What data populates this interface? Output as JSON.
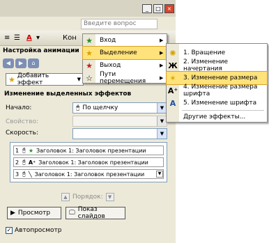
{
  "window": {
    "search_placeholder": "Введите вопрос",
    "btn_min": "_",
    "btn_max": "□",
    "btn_close": "×"
  },
  "toolbar": {
    "font_color_icon": "A",
    "kon_label": "Кон"
  },
  "pane": {
    "title": "Настройка анимации",
    "add_effect": "Добавить эффект",
    "section_title": "Изменение выделенных эффектов",
    "start_label": "Начало:",
    "start_value": "По щелчку",
    "property_label": "Свойство:",
    "speed_label": "Скорость:",
    "list": [
      {
        "num": "1",
        "text": "Заголовок 1: Заголовок презентации"
      },
      {
        "num": "2",
        "text": "Заголовок 1: Заголовок презентации"
      },
      {
        "num": "3",
        "text": "Заголовок 1: Заголовок презентации"
      }
    ],
    "order_label": "Порядок:",
    "preview_label": "Просмотр",
    "slideshow_label": "Показ слайдов",
    "autopreview_label": "Автопросмотр"
  },
  "menu": {
    "items": [
      {
        "label": "Вход",
        "has_submenu": true,
        "icon": "star-green-icon"
      },
      {
        "label": "Выделение",
        "has_submenu": true,
        "highlighted": true,
        "icon": "star-yellow-icon"
      },
      {
        "label": "Выход",
        "has_submenu": true,
        "icon": "star-red-icon"
      },
      {
        "label": "Пути перемещения",
        "has_submenu": true,
        "icon": "path-icon"
      }
    ]
  },
  "submenu": {
    "items": [
      {
        "label": "1. Вращение",
        "icon": "rotate-icon"
      },
      {
        "label": "2. Изменение начертания",
        "icon": "bold-icon"
      },
      {
        "label": "3. Изменение размера",
        "icon": "resize-icon",
        "highlighted": true
      },
      {
        "label": "4. Изменение размера шрифта",
        "icon": "font-size-icon"
      },
      {
        "label": "5. Изменение шрифта",
        "icon": "font-icon"
      },
      {
        "label": "Другие эффекты...",
        "icon": ""
      }
    ]
  },
  "colors": {
    "highlight": "#ffe27a",
    "pane_bg": "#ece9d8",
    "accent_blue": "#1f4fa0"
  }
}
